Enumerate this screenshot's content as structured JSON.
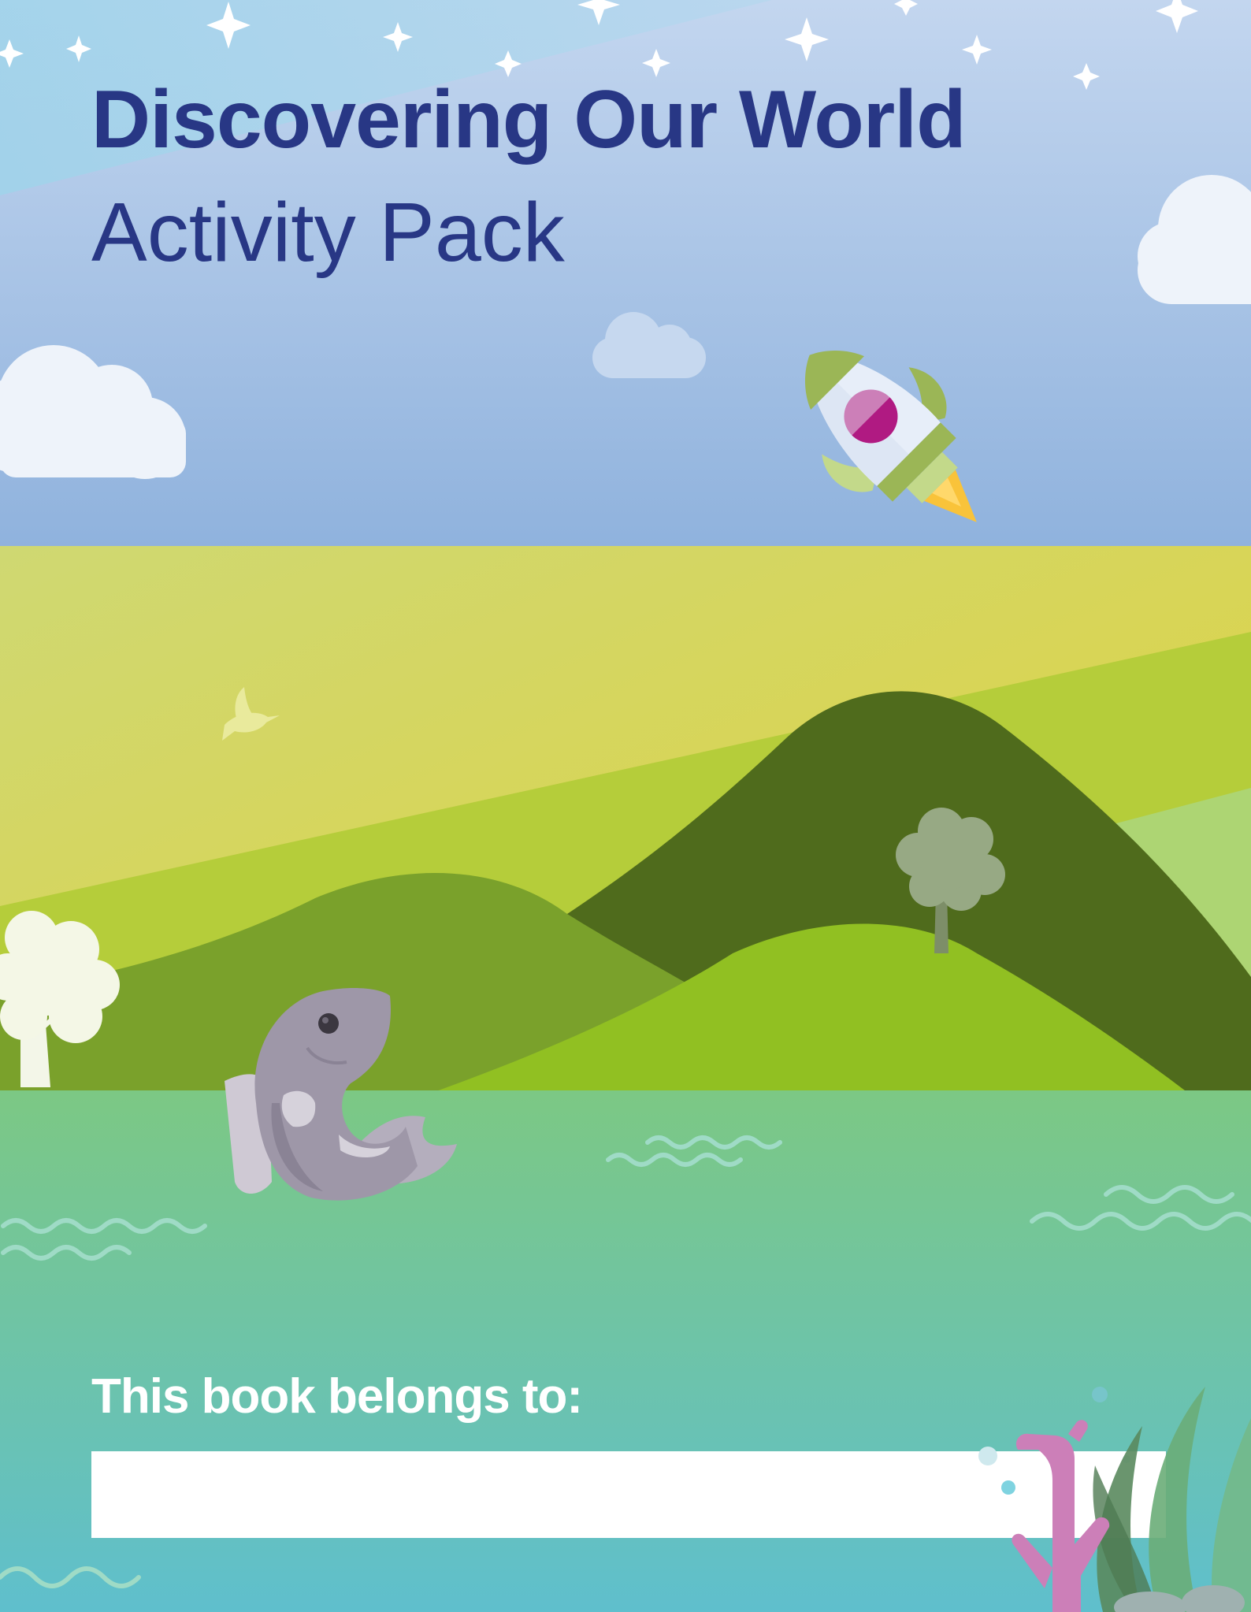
{
  "cover": {
    "title": "Discovering Our World",
    "subtitle": "Activity Pack",
    "belongs_label": "This book belongs to:",
    "name_value": ""
  },
  "palette": {
    "title_navy": "#283785",
    "sky_top": "#b5d6ec",
    "sky_bottom": "#8fb2dd",
    "field_yellow": "#dcd34a",
    "hill_dark": "#4f6b1c",
    "hill_mid": "#7aa12b",
    "hill_light": "#91c022",
    "water_top": "#7cc884",
    "water_bottom": "#61c0cc",
    "coral_pink": "#cc7fb8",
    "rocket_magenta": "#b01a82",
    "fish_grey": "#9e97a8"
  },
  "illustration": {
    "icons": [
      "star-icon",
      "cloud-icon",
      "rocket-icon",
      "bird-icon",
      "tree-icon",
      "fish-icon",
      "wave-icon",
      "coral-icon",
      "seaweed-icon"
    ]
  }
}
